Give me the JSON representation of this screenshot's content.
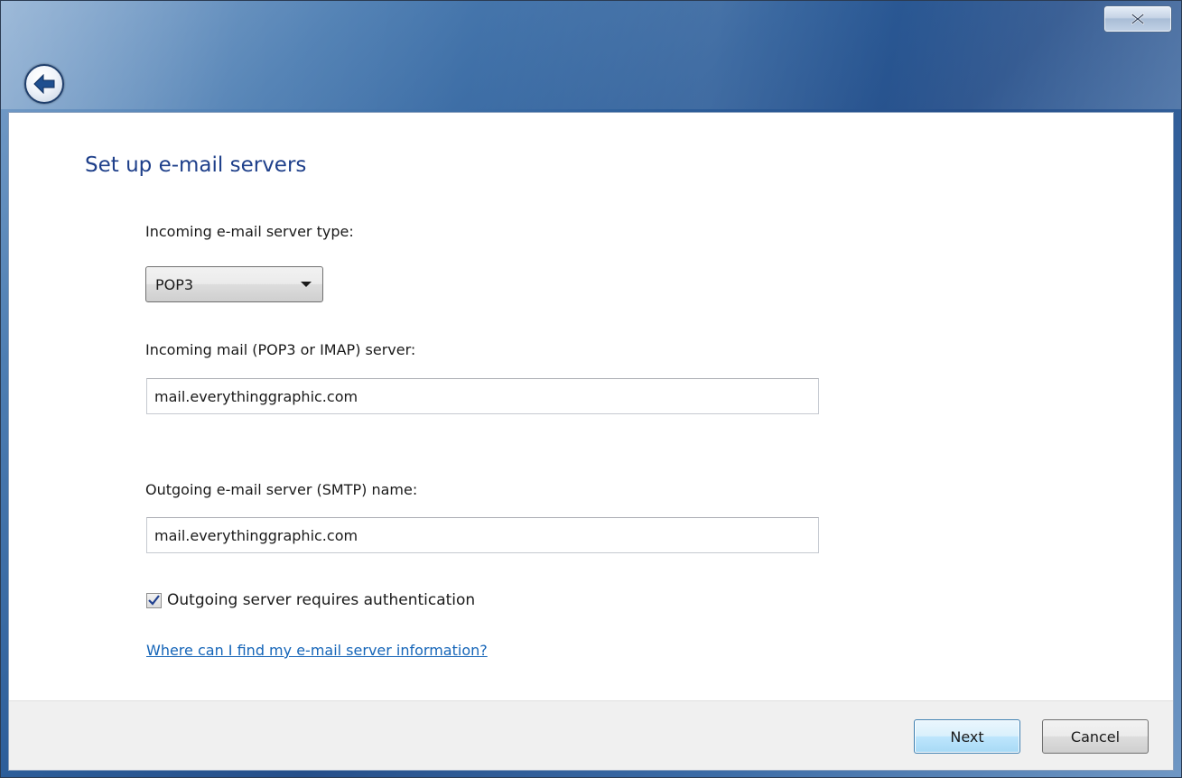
{
  "window": {
    "close_label": "x"
  },
  "page": {
    "title": "Set up e-mail servers"
  },
  "incoming_type": {
    "label": "Incoming e-mail server type:",
    "selected": "POP3"
  },
  "incoming_server": {
    "label": "Incoming mail (POP3 or IMAP) server:",
    "value": "mail.everythinggraphic.com"
  },
  "outgoing_server": {
    "label": "Outgoing e-mail server (SMTP) name:",
    "value": "mail.everythinggraphic.com"
  },
  "auth": {
    "label": "Outgoing server requires authentication",
    "checked": true
  },
  "help": {
    "link_text": "Where can I find my e-mail server information?"
  },
  "footer": {
    "next_label": "Next",
    "cancel_label": "Cancel"
  },
  "icons": [
    "close-icon",
    "back-arrow-icon",
    "dropdown-arrow-icon",
    "checkmark-icon"
  ],
  "colors": {
    "title": "#1e3f8a",
    "link": "#1565b8",
    "frame": "#2c5d99"
  }
}
